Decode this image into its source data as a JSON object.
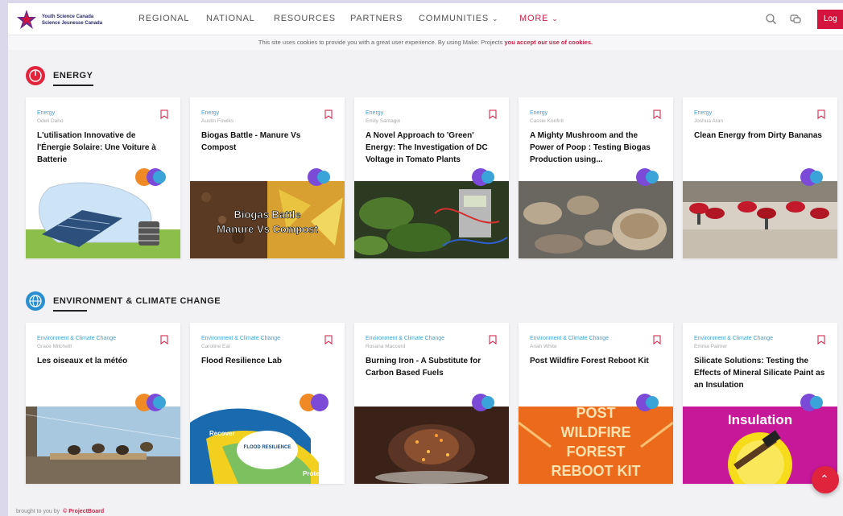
{
  "header": {
    "logo_line1": "Youth Science Canada",
    "logo_line2": "Science Jeunesse Canada",
    "nav": [
      {
        "label": "REGIONAL"
      },
      {
        "label": "NATIONAL"
      },
      {
        "label": "RESOURCES"
      },
      {
        "label": "PARTNERS"
      },
      {
        "label": "COMMUNITIES"
      },
      {
        "label": "MORE"
      }
    ],
    "login_label": "Log"
  },
  "cookie": {
    "text": "This site uses cookies to provide you with a great user experience. By using Make: Projects",
    "link": "you accept our use of cookies."
  },
  "sections": [
    {
      "title": "ENERGY",
      "icon_color": "#e0243c",
      "icon": "energy-icon",
      "cards": [
        {
          "category": "Energy",
          "author": "Odeli Daho",
          "title": "L'utilisation Innovative de l'Énergie Solaire: Une Voiture à Batterie"
        },
        {
          "category": "Energy",
          "author": "Austin Fowlks",
          "title": "Biogas Battle - Manure Vs Compost"
        },
        {
          "category": "Energy",
          "author": "Emily Santagin",
          "title": "A Novel Approach to 'Green' Energy: The Investigation of DC Voltage in Tomato Plants"
        },
        {
          "category": "Energy",
          "author": "Cassie Konfirit",
          "title": "A Mighty Mushroom and the Power of Poop : Testing Biogas Production using..."
        },
        {
          "category": "Energy",
          "author": "Joshua Aran",
          "title": "Clean Energy from Dirty Bananas"
        }
      ]
    },
    {
      "title": "ENVIRONMENT & CLIMATE CHANGE",
      "icon_color": "#2a8fd0",
      "icon": "globe-icon",
      "cards": [
        {
          "category": "Environment & Climate Change",
          "author": "Grace Mitchelll",
          "title": "Les oiseaux et la météo"
        },
        {
          "category": "Environment & Climate Change",
          "author": "Caroline Eat",
          "title": "Flood Resilience Lab"
        },
        {
          "category": "Environment & Climate Change",
          "author": "Rosana Maccord",
          "title": "Burning Iron - A Substitute for Carbon Based Fuels"
        },
        {
          "category": "Environment & Climate Change",
          "author": "Anah White",
          "title": "Post Wildfire Forest Reboot Kit"
        },
        {
          "category": "Environment & Climate Change",
          "author": "Emma Palmer",
          "title": "Silicate Solutions: Testing the Effects of Mineral Silicate Paint as an Insulation"
        }
      ]
    }
  ],
  "thumb_text": {
    "biogas_1": "Biogas Battle",
    "biogas_2": "Manure Vs Compost",
    "flood": "FLOOD RESILIENCE",
    "recover": "Recover",
    "protect": "Protect",
    "wildfire_1": "POST",
    "wildfire_2": "WILDFIRE",
    "wildfire_3": "FOREST",
    "wildfire_4": "REBOOT KIT",
    "insulation": "Insulation"
  },
  "footer": {
    "text": "brought to you by",
    "brand": "© ProjectBoard"
  },
  "colors": {
    "accent": "#c8234a",
    "category": "#3aa3d8",
    "badge_purple": "#7b4bd8",
    "badge_orange": "#f08a24"
  }
}
